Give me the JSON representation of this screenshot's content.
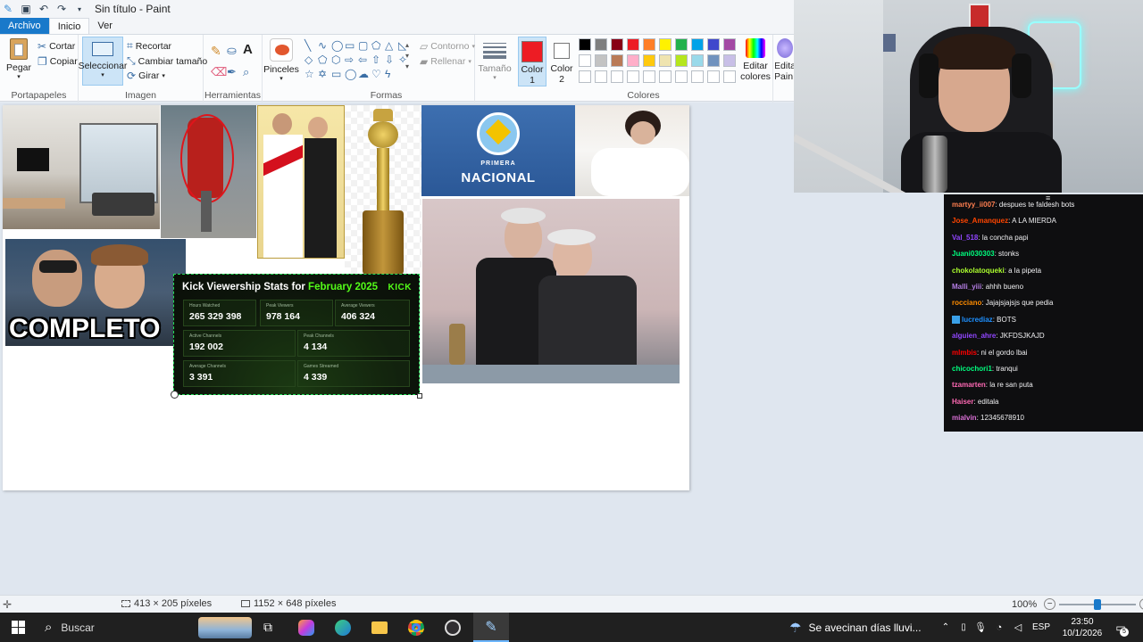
{
  "titlebar": {
    "title": "Sin título - Paint",
    "icons": [
      "paint-app-icon",
      "save-icon",
      "undo-icon",
      "redo-icon",
      "customize-icon"
    ]
  },
  "tabs": {
    "file": "Archivo",
    "home": "Inicio",
    "view": "Ver"
  },
  "ribbon": {
    "clipboard": {
      "paste": "Pegar",
      "cut": "Cortar",
      "copy": "Copiar",
      "label": "Portapapeles"
    },
    "image": {
      "select": "Seleccionar",
      "crop": "Recortar",
      "resize": "Cambiar tamaño",
      "rotate": "Girar",
      "label": "Imagen"
    },
    "tools": {
      "label": "Herramientas",
      "brushes": "Pinceles"
    },
    "shapes": {
      "outline": "Contorno",
      "fill": "Rellenar",
      "label": "Formas"
    },
    "size": "Tamaño",
    "color1": "Color",
    "color1_num": "1",
    "color2": "Color",
    "color2_num": "2",
    "colors_label": "Colores",
    "edit_colors": "Editar colores",
    "edit_paint3d": "Edita Pain",
    "palette": [
      "#000000",
      "#7f7f7f",
      "#880015",
      "#ed1c24",
      "#ff7f27",
      "#fff200",
      "#22b14c",
      "#00a2e8",
      "#3f48cc",
      "#a349a4",
      "#ffffff",
      "#c3c3c3",
      "#b97a57",
      "#ffaec9",
      "#ffc90e",
      "#efe4b0",
      "#b5e61d",
      "#99d9ea",
      "#7092be",
      "#c8bfe7"
    ],
    "color1_value": "#ed1c24",
    "color2_value": "#ffffff"
  },
  "canvas_content": {
    "thumb_text": "COMPLETO",
    "primera_nacional": [
      "PRIMERA",
      "NACIONAL"
    ],
    "kick_card": {
      "title_prefix": "Kick Viewership Stats for ",
      "title_month": "February 2025",
      "logo": "KICK",
      "stats": [
        {
          "label": "Hours Watched",
          "value": "265 329 398",
          "delta": "",
          "neg": false
        },
        {
          "label": "Peak Viewers",
          "value": "978 164",
          "delta": "",
          "neg": true
        },
        {
          "label": "Average Viewers",
          "value": "406 324",
          "delta": "",
          "neg": false
        },
        {
          "label": "Active Channels",
          "value": "192 002",
          "delta": "",
          "neg": true
        },
        {
          "label": "Peak Channels",
          "value": "4 134",
          "delta": "",
          "neg": false
        },
        {
          "label": "Average Channels",
          "value": "3 391",
          "delta": "",
          "neg": false
        },
        {
          "label": "Games Streamed",
          "value": "4 339",
          "delta": "",
          "neg": false
        }
      ]
    }
  },
  "chat": {
    "messages": [
      {
        "user": "martyy_ii007",
        "text": ": despues te faldesh bots",
        "color": "#ff7f50"
      },
      {
        "user": "Jose_Amanquez",
        "text": ": A LA MIERDA",
        "color": "#ff4500"
      },
      {
        "user": "Val_518",
        "text": ": la concha papi",
        "color": "#9146ff"
      },
      {
        "user": "Juani030303",
        "text": ": stonks",
        "color": "#00ff7f"
      },
      {
        "user": "chokolatoqueki",
        "text": ": a la pipeta",
        "color": "#adff2f"
      },
      {
        "user": "Malli_yiii",
        "text": ": ahhh bueno",
        "color": "#b57ee5"
      },
      {
        "user": "rocciano",
        "text": ": Jajajsjajsjs que pedia",
        "color": "#ff8c00"
      },
      {
        "user": "lucrediaz",
        "text": ": BOTS",
        "color": "#1e90ff"
      },
      {
        "user": "alguien_ahre",
        "text": ": JKFDSJKAJD",
        "color": "#9146ff"
      },
      {
        "user": "mlmbis",
        "text": ": ni el gordo lbai",
        "color": "#ff0000"
      },
      {
        "user": "chicochori1",
        "text": ": tranqui",
        "color": "#00ff7f"
      },
      {
        "user": "tzamarten",
        "text": ": la re san puta",
        "color": "#ff69b4"
      },
      {
        "user": "Haiser",
        "text": ": editala",
        "color": "#ff69b4"
      },
      {
        "user": "mialvin",
        "text": ": 12345678910",
        "color": "#da70d6"
      }
    ]
  },
  "statusbar": {
    "selection_size": "413 × 205 píxeles",
    "canvas_size": "1152 × 648 píxeles",
    "zoom": "100%",
    "zoom_level": 0.5
  },
  "taskbar": {
    "search_label": "Buscar",
    "weather_text": "Se avecinan días lluvi...",
    "language": "ESP",
    "time": "23:50",
    "date": "10/1/2026",
    "notifications": "5"
  }
}
